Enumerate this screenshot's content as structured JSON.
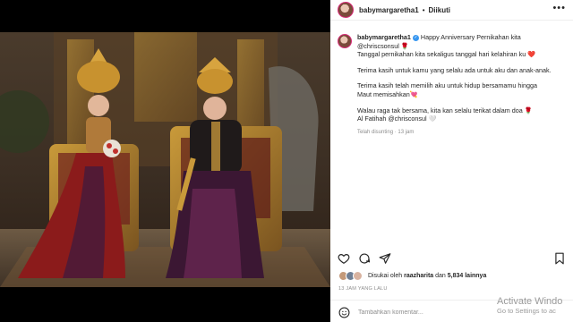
{
  "header": {
    "username": "babymargaretha1",
    "separator": "•",
    "follow_label": "Diikuti",
    "more_icon": "more-icon"
  },
  "caption": {
    "username": "babymargaretha1",
    "line1": "Happy Anniversary Pernikahan kita",
    "line2": "@chriscsonsul 🌹",
    "line3": "Tanggal pernikahan kita sekaligus tanggal hari kelahiran ku ❤️",
    "para2": "Terima kasih untuk kamu yang selalu ada untuk aku dan anak-anak.",
    "para3a": "Terima kasih telah memilih aku untuk hidup bersamamu hingga",
    "para3b": "Maut memisahkan💘",
    "para4a": "Walau raga tak bersama, kita kan selalu terikat dalam doa 🌹",
    "para4b": "Al Fatihah @chrisconsul 🤍",
    "edited": "Telah disunting · 13 jam"
  },
  "likes": {
    "prefix": "Disukai oleh",
    "user": "raazharita",
    "middle": "dan",
    "count": "5,834 lainnya"
  },
  "time_ago": "13 JAM YANG LALU",
  "comment": {
    "placeholder": "Tambahkan komentar..."
  },
  "watermark": {
    "line1": "Activate Windo",
    "line2": "Go to Settings to ac"
  },
  "colors": {
    "accent_ring": "#d62976",
    "text": "#262626",
    "muted": "#8e8e8e",
    "border": "#efefef"
  }
}
